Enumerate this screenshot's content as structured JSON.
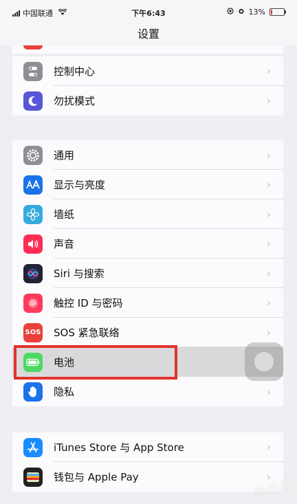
{
  "status_bar": {
    "carrier": "中国联通",
    "time": "下午6:43",
    "battery_percent": "13%",
    "battery_level": 0.13,
    "battery_color": "#e2312d"
  },
  "nav": {
    "title": "设置"
  },
  "groups": [
    {
      "items": [
        {
          "label": "控制中心",
          "icon": "control-center-icon",
          "icon_color": "#8e8e93"
        },
        {
          "label": "勿扰模式",
          "icon": "moon-icon",
          "icon_color": "#5856d6"
        }
      ]
    },
    {
      "items": [
        {
          "label": "通用",
          "icon": "gear-icon",
          "icon_color": "#8e8e93"
        },
        {
          "label": "显示与亮度",
          "icon": "aa-icon",
          "icon_color": "#1a73e8"
        },
        {
          "label": "墙纸",
          "icon": "flower-icon",
          "icon_color": "#34aadc"
        },
        {
          "label": "声音",
          "icon": "speaker-icon",
          "icon_color": "#ff2d55"
        },
        {
          "label": "Siri 与搜索",
          "icon": "siri-icon",
          "icon_color": "#222233"
        },
        {
          "label": "触控 ID 与密码",
          "icon": "fingerprint-icon",
          "icon_color": "#ff3b5c"
        },
        {
          "label": "SOS 紧急联络",
          "icon": "sos-icon",
          "icon_color": "#e8403a",
          "icon_text": "SOS"
        },
        {
          "label": "电池",
          "icon": "battery-icon",
          "icon_color": "#4cd964",
          "highlighted": true
        },
        {
          "label": "隐私",
          "icon": "hand-icon",
          "icon_color": "#1a73e8"
        }
      ]
    },
    {
      "items": [
        {
          "label": "iTunes Store 与 App Store",
          "icon": "app-store-icon",
          "icon_color": "#1a8cff"
        },
        {
          "label": "钱包与 Apple Pay",
          "icon": "wallet-icon",
          "icon_color": "#222222"
        }
      ]
    }
  ],
  "watermark": "新机汇"
}
